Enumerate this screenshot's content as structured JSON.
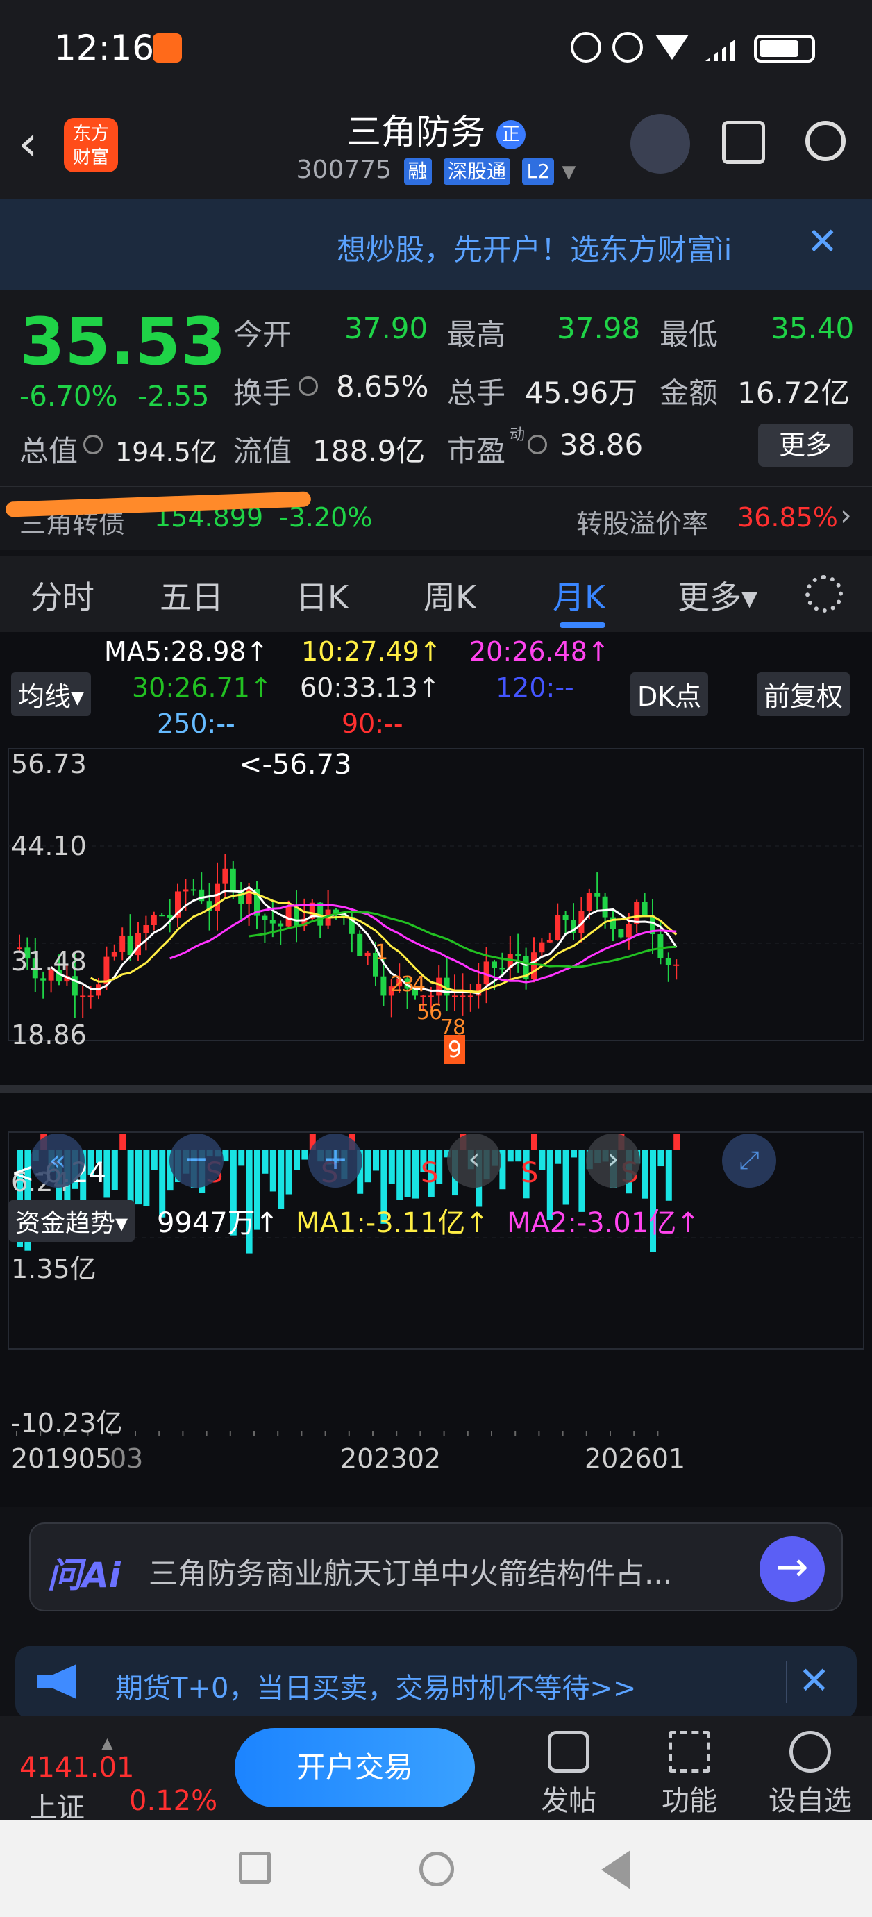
{
  "status": {
    "time": "12:16"
  },
  "header": {
    "back": "‹",
    "logo_text": "东方\n财富",
    "title": "三角防务",
    "title_badge": "正",
    "code": "300775",
    "tags": [
      "融",
      "深股通",
      "L2"
    ]
  },
  "banner": {
    "text": "想炒股，先开户！选东方财富ìi",
    "close": "✕"
  },
  "quote": {
    "price": "35.53",
    "change_pct": "-6.70%",
    "change_abs": "-2.55",
    "open_label": "今开",
    "open": "37.90",
    "high_label": "最高",
    "high": "37.98",
    "low_label": "最低",
    "low": "35.40",
    "turnover_label": "换手",
    "turnover": "8.65%",
    "volume_label": "总手",
    "volume": "45.96万",
    "amount_label": "金额",
    "amount": "16.72亿",
    "mktcap_label": "总值",
    "mktcap": "194.5亿",
    "float_label": "流值",
    "float": "188.9亿",
    "pe_label": "市盈",
    "pe_sup": "动",
    "pe": "38.86",
    "more": "更多"
  },
  "convertible": {
    "name": "三角转债",
    "price": "154.899",
    "change": "-3.20%",
    "premium_label": "转股溢价率",
    "premium": "36.85%",
    "arrow": "›"
  },
  "tabs": [
    "分时",
    "五日",
    "日K",
    "周K",
    "月K",
    "更多▾"
  ],
  "active_tab": "月K",
  "ma": {
    "ma5": "MA5:28.98↑",
    "ma10": "10:27.49↑",
    "ma20": "20:26.48↑",
    "ma30": "30:26.71↑",
    "ma60": "60:33.13↑",
    "ma120": "120:--",
    "ma250": "250:--",
    "ma90": "90:--",
    "indicator_btn": "均线▾",
    "dk_btn": "DK点",
    "adjust_btn": "前复权"
  },
  "kchart": {
    "y_labels": [
      "56.73",
      "44.10",
      "31.48",
      "18.86",
      "6.24"
    ],
    "max_label": "<-56.73",
    "min_label": "<-6.24",
    "s_marks": [
      "S",
      "S",
      "S",
      "S",
      "S"
    ],
    "seq_marks": [
      "1",
      "2",
      "3",
      "4",
      "5",
      "6",
      "7",
      "8",
      "9"
    ]
  },
  "fund": {
    "label": "资金趋势▾",
    "value": "9947万↑",
    "ma1": "MA1:-3.11亿↑",
    "ma2": "MA2:-3.01亿↑",
    "y_top": "1.35亿",
    "y_bottom": "-10.23亿",
    "x_labels": [
      "201905",
      "03",
      "202302",
      "202601"
    ]
  },
  "ask": {
    "logo": "问Ai",
    "text": "三角防务商业航天订单中火箭结构件占...",
    "go": "→"
  },
  "ad": {
    "text": "期货T+0，当日买卖，交易时机不等待>>",
    "close": "✕"
  },
  "bottom": {
    "index_value": "4141.01",
    "index_name": "上证",
    "index_change": "0.12%",
    "trade_btn": "开户交易",
    "nav": [
      "发帖",
      "功能",
      "设自选"
    ]
  },
  "colors": {
    "up": "#ff3030",
    "down": "#1fd347",
    "accent": "#3a86ff",
    "ma5": "#ffffff",
    "ma10": "#ffee44",
    "ma20": "#ff33ff",
    "ma30": "#22c022"
  }
}
